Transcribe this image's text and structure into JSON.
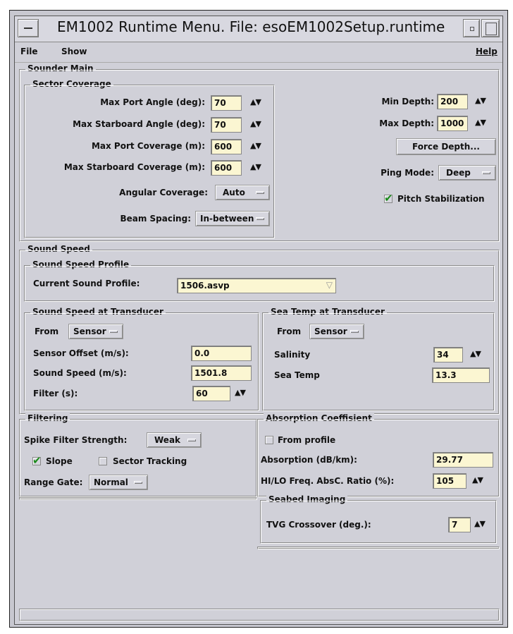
{
  "window": {
    "title": "EM1002 Runtime Menu. File: esoEM1002Setup.runtime"
  },
  "menubar": {
    "file": "File",
    "show": "Show",
    "help": "Help"
  },
  "sounder_main": {
    "title": "Sounder Main",
    "sector_coverage": {
      "title": "Sector Coverage",
      "max_port_angle_label": "Max Port Angle (deg):",
      "max_port_angle": "70",
      "max_stbd_angle_label": "Max Starboard Angle (deg):",
      "max_stbd_angle": "70",
      "max_port_cov_label": "Max Port Coverage (m):",
      "max_port_cov": "600",
      "max_stbd_cov_label": "Max Starboard Coverage (m):",
      "max_stbd_cov": "600",
      "angular_cov_label": "Angular Coverage:",
      "angular_cov": "Auto",
      "beam_spacing_label": "Beam Spacing:",
      "beam_spacing": "In-between"
    },
    "min_depth_label": "Min Depth:",
    "min_depth": "200",
    "max_depth_label": "Max Depth:",
    "max_depth": "1000",
    "force_depth": "Force Depth...",
    "ping_mode_label": "Ping Mode:",
    "ping_mode": "Deep",
    "pitch_stab_label": "Pitch Stabilization"
  },
  "sound_speed": {
    "title": "Sound Speed",
    "profile_title": "Sound Speed Profile",
    "current_profile_label": "Current Sound Profile:",
    "current_profile": "1506.asvp",
    "transducer": {
      "title": "Sound Speed at Transducer",
      "from_label": "From",
      "from": "Sensor",
      "sensor_offset_label": "Sensor Offset (m/s):",
      "sensor_offset": "0.0",
      "sound_speed_label": "Sound Speed (m/s):",
      "sound_speed": "1501.8",
      "filter_label": "Filter (s):",
      "filter": "60"
    },
    "sea_temp": {
      "title": "Sea Temp at Transducer",
      "from_label": "From",
      "from": "Sensor",
      "salinity_label": "Salinity",
      "salinity": "34",
      "sea_temp_label": "Sea Temp",
      "sea_temp": "13.3"
    }
  },
  "filtering": {
    "title": "Filtering",
    "spike_label": "Spike Filter Strength:",
    "spike": "Weak",
    "slope_label": "Slope",
    "sector_tracking_label": "Sector Tracking",
    "range_gate_label": "Range Gate:",
    "range_gate": "Normal"
  },
  "absorption": {
    "title": "Absorption Coeffisient",
    "from_profile_label": "From profile",
    "absorption_label": "Absorption (dB/km):",
    "absorption": "29.77",
    "ratio_label": "HI/LO Freq. AbsC. Ratio (%):",
    "ratio": "105"
  },
  "seabed": {
    "title": "Seabed Imaging",
    "tvg_label": "TVG Crossover (deg.):",
    "tvg": "7"
  },
  "glyphs": {
    "spin": "▲▼",
    "tick": "✔",
    "dropdown": "▽"
  }
}
